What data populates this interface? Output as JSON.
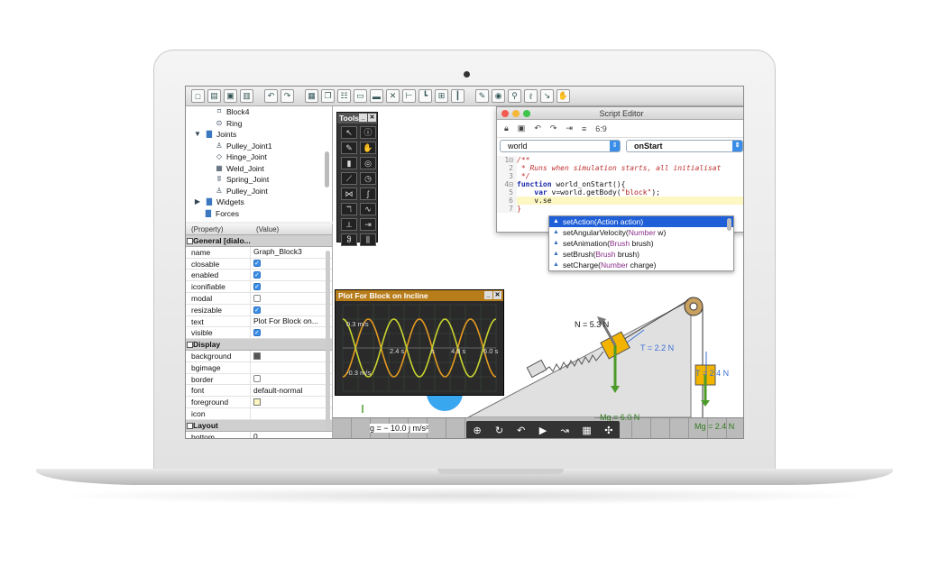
{
  "toolbar": {
    "icons": [
      "new-icon",
      "open-icon",
      "save-icon",
      "print-icon",
      "undo-icon",
      "redo-icon",
      "lock-icon",
      "copy-icon",
      "grid-icon",
      "window-icon",
      "panel-icon",
      "crop-icon",
      "joint-icon",
      "axis-icon",
      "table-icon",
      "chart-icon",
      "pin-icon",
      "globe-icon",
      "link-icon",
      "key-icon",
      "pointer-icon",
      "hand-icon"
    ],
    "glyphs": [
      "□",
      "▤",
      "▣",
      "▥",
      "↶",
      "↷",
      "▦",
      "❐",
      "☷",
      "▭",
      "▬",
      "✕",
      "⊢",
      "┗",
      "⊞",
      "┃",
      "✎",
      "◉",
      "⚲",
      "ℓ",
      "↘",
      "✋"
    ]
  },
  "tree": {
    "items": [
      {
        "label": "Block4",
        "icon": "⌑",
        "indent": 3
      },
      {
        "label": "Ring",
        "icon": "⊙",
        "indent": 3
      },
      {
        "label": "Joints",
        "icon": "▇",
        "indent": 1,
        "folder": true,
        "toggle": "▼"
      },
      {
        "label": "Pulley_Joint1",
        "icon": "♙",
        "indent": 3
      },
      {
        "label": "Hinge_Joint",
        "icon": "◇",
        "indent": 3
      },
      {
        "label": "Weld_Joint",
        "icon": "▦",
        "indent": 3
      },
      {
        "label": "Spring_Joint",
        "icon": "ʬ",
        "indent": 3
      },
      {
        "label": "Pulley_Joint",
        "icon": "♙",
        "indent": 3
      },
      {
        "label": "Widgets",
        "icon": "▇",
        "indent": 1,
        "folder": true,
        "toggle": "▶"
      },
      {
        "label": "Forces",
        "icon": "▇",
        "indent": 2,
        "folder": true
      }
    ]
  },
  "props": {
    "col_property": "(Property)",
    "col_value": "(Value)",
    "rows": [
      {
        "section": "General [dialo..."
      },
      {
        "name": "name",
        "value": "Graph_Block3"
      },
      {
        "name": "closable",
        "check": true
      },
      {
        "name": "enabled",
        "check": true
      },
      {
        "name": "iconifiable",
        "check": true
      },
      {
        "name": "modal",
        "check": false
      },
      {
        "name": "resizable",
        "check": true
      },
      {
        "name": "text",
        "value": "Plot For Block on..."
      },
      {
        "name": "visible",
        "check": true
      },
      {
        "section": "Display"
      },
      {
        "name": "background",
        "swatch": "#555555"
      },
      {
        "name": "bgimage",
        "value": ""
      },
      {
        "name": "border",
        "check": false
      },
      {
        "name": "font",
        "value": "default-normal"
      },
      {
        "name": "foreground",
        "swatch": "#fff6c0"
      },
      {
        "name": "icon",
        "value": ""
      },
      {
        "section": "Layout"
      },
      {
        "name": "bottom",
        "value": "0"
      }
    ]
  },
  "tools": {
    "title": "Tools",
    "glyphs": [
      "↖",
      "ⓘ",
      "✎",
      "✋",
      "▮",
      "◎",
      "⟋",
      "◷",
      "⋈",
      "ʃ",
      "ℸ",
      "∿",
      "⟂",
      "⇥",
      "ჵ",
      "⫼"
    ],
    "names": [
      "select-icon",
      "info-icon",
      "pen-icon",
      "grab-icon",
      "block-icon",
      "camera-icon",
      "graph-icon",
      "clock-icon",
      "spring-icon",
      "rope-icon",
      "hinge-icon",
      "wave-icon",
      "angle-icon",
      "ruler-icon",
      "hook-icon",
      "slider-icon"
    ]
  },
  "plot": {
    "title": "Plot For Block on Incline",
    "labels": [
      "0.3 m/s",
      "-0.3 m/s",
      "2.4 s",
      "3.6 s",
      "4.8 s",
      "6.0 s"
    ],
    "ytop": "0.3 m/s",
    "ybot": "-0.3 m/s",
    "xlabels": [
      "2.4 s",
      "s",
      "4.8 s",
      "6.0 s"
    ]
  },
  "editor": {
    "title": "Script Editor",
    "cursor": "6:9",
    "object": "world",
    "event": "onStart",
    "lines": [
      {
        "n": "1⊟",
        "text": "/**",
        "cls": "cm"
      },
      {
        "n": "2",
        "text": " * Runs when simulation starts, all initialisat",
        "cls": "cm"
      },
      {
        "n": "3",
        "text": " */",
        "cls": "cm"
      },
      {
        "n": "4⊟",
        "kw": "function",
        "text": " world_onStart(){"
      },
      {
        "n": "5",
        "pre": "    ",
        "kw": "var",
        "text": " v=world.getBody(",
        "str": "\"block\"",
        "post": ");"
      },
      {
        "n": "6",
        "text": "    v.se",
        "hl": true
      },
      {
        "n": "7",
        "text": "}",
        "cls": "str"
      }
    ]
  },
  "autocomplete": [
    {
      "method": "setAction(",
      "ptype": "Action",
      "pname": " action)",
      "selected": true
    },
    {
      "method": "setAngularVelocity(",
      "ptype": "Number",
      "pname": " w)"
    },
    {
      "method": "setAnimation(",
      "ptype": "Brush",
      "pname": " brush)"
    },
    {
      "method": "setBrush(",
      "ptype": "Brush",
      "pname": " brush)"
    },
    {
      "method": "setCharge(",
      "ptype": "Number",
      "pname": " charge)"
    }
  ],
  "sim": {
    "normal_force": "N = 5.3 N",
    "tension_top": "T = 2.2 N",
    "tension_right": "T = 2.4 N",
    "weight_block": "Mg = 6.0 N",
    "weight_hanging": "Mg = 2.4 N",
    "gravity": "g = − 10.0 j m/s²"
  },
  "controls": {
    "glyphs": [
      "⊕",
      "↻",
      "↶",
      "▶",
      "↝",
      "▦",
      "✣"
    ],
    "names": [
      "zoom-icon",
      "reset-icon",
      "step-back-icon",
      "play-icon",
      "step-icon",
      "grid-icon",
      "move-icon"
    ]
  },
  "colors": {
    "plot_yellow": "#c8d430",
    "plot_orange": "#e49a20",
    "block": "#f2b400",
    "force_arrow": "#4c9a2a",
    "tension_text": "#3b6fd8"
  }
}
